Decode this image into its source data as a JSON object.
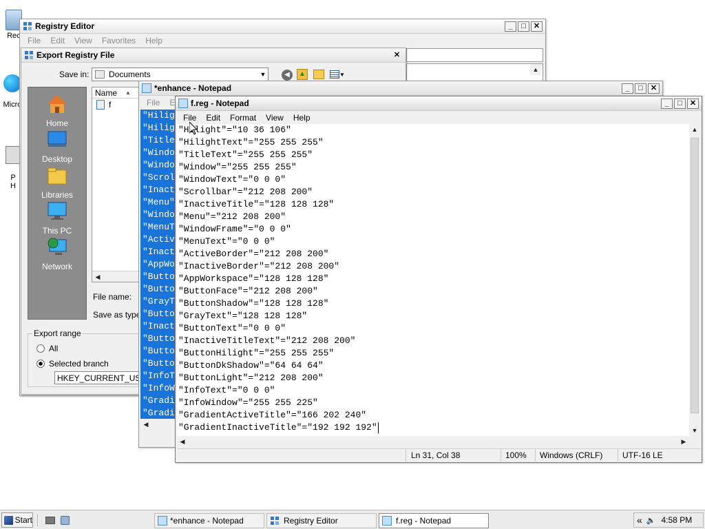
{
  "desktop": {
    "icons": [
      {
        "label": "Rec",
        "icon": "recycle-bin-icon"
      },
      {
        "label": "Micro",
        "icon": "edge-icon"
      },
      {
        "label": "P\nH",
        "icon": "shortcut-icon"
      }
    ]
  },
  "registry_editor": {
    "title": "Registry Editor",
    "menu": [
      "File",
      "Edit",
      "View",
      "Favorites",
      "Help"
    ]
  },
  "export_dialog": {
    "title": "Export Registry File",
    "save_in_label": "Save in:",
    "save_in_value": "Documents",
    "places": [
      "Home",
      "Desktop",
      "Libraries",
      "This PC",
      "Network"
    ],
    "column_name": "Name",
    "file_item": "f",
    "file_name_label": "File name:",
    "save_as_type_label": "Save as type:",
    "export_range_label": "Export range",
    "option_all": "All",
    "option_selected": "Selected branch",
    "branch_value": "HKEY_CURRENT_USER"
  },
  "enhance_notepad": {
    "title": "*enhance - Notepad",
    "menu": [
      "File",
      "Edit"
    ],
    "lines": [
      "\"Hilight",
      "\"Hilight",
      "\"TitleT",
      "\"Windo",
      "\"Windo",
      "\"Scrol",
      "\"Inact",
      "\"Menu\"",
      "\"Windo",
      "\"MenuT",
      "\"Activ",
      "\"Inact",
      "\"AppWo",
      "\"Butto",
      "\"Butto",
      "\"GrayT",
      "\"Butto",
      "\"Inact",
      "\"Butto",
      "\"Butto",
      "\"Butto",
      "\"InfoT",
      "\"InfoW",
      "\"Gradi",
      "\"Gradi"
    ]
  },
  "freg_notepad": {
    "title": "f.reg - Notepad",
    "menu": [
      "File",
      "Edit",
      "Format",
      "View",
      "Help"
    ],
    "lines": [
      "\"Hilight\"=\"10 36 106\"",
      "\"HilightText\"=\"255 255 255\"",
      "\"TitleText\"=\"255 255 255\"",
      "\"Window\"=\"255 255 255\"",
      "\"WindowText\"=\"0 0 0\"",
      "\"Scrollbar\"=\"212 208 200\"",
      "\"InactiveTitle\"=\"128 128 128\"",
      "\"Menu\"=\"212 208 200\"",
      "\"WindowFrame\"=\"0 0 0\"",
      "\"MenuText\"=\"0 0 0\"",
      "\"ActiveBorder\"=\"212 208 200\"",
      "\"InactiveBorder\"=\"212 208 200\"",
      "\"AppWorkspace\"=\"128 128 128\"",
      "\"ButtonFace\"=\"212 208 200\"",
      "\"ButtonShadow\"=\"128 128 128\"",
      "\"GrayText\"=\"128 128 128\"",
      "\"ButtonText\"=\"0 0 0\"",
      "\"InactiveTitleText\"=\"212 208 200\"",
      "\"ButtonHilight\"=\"255 255 255\"",
      "\"ButtonDkShadow\"=\"64 64 64\"",
      "\"ButtonLight\"=\"212 208 200\"",
      "\"InfoText\"=\"0 0 0\"",
      "\"InfoWindow\"=\"255 255 225\"",
      "\"GradientActiveTitle\"=\"166 202 240\"",
      "\"GradientInactiveTitle\"=\"192 192 192\""
    ],
    "status": {
      "position": "Ln 31, Col 38",
      "zoom": "100%",
      "line_ending": "Windows (CRLF)",
      "encoding": "UTF-16 LE"
    }
  },
  "taskbar": {
    "start_label": "Start",
    "buttons": [
      "*enhance - Notepad",
      "Registry Editor",
      "f.reg - Notepad"
    ],
    "tray_chevron": "«",
    "clock": "4:58 PM"
  },
  "colors": {
    "selection": "#1874d8",
    "dialog_sidebar": "#8c8c8c"
  }
}
